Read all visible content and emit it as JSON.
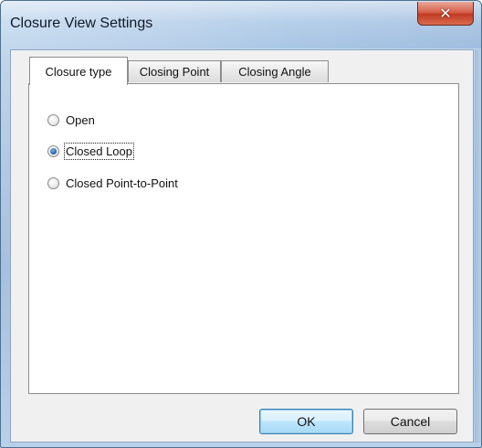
{
  "window": {
    "title": "Closure View Settings",
    "close_icon": "close-icon"
  },
  "tabs": [
    {
      "label": "Closure type",
      "active": true
    },
    {
      "label": "Closing Point",
      "active": false
    },
    {
      "label": "Closing Angle",
      "active": false
    }
  ],
  "closure_type": {
    "options": [
      {
        "label": "Open",
        "checked": false
      },
      {
        "label": "Closed Loop",
        "checked": true
      },
      {
        "label": "Closed Point-to-Point",
        "checked": false
      }
    ]
  },
  "buttons": {
    "ok": "OK",
    "cancel": "Cancel"
  },
  "colors": {
    "close_button": "#c13b24",
    "default_button": "#3c7fb1"
  }
}
